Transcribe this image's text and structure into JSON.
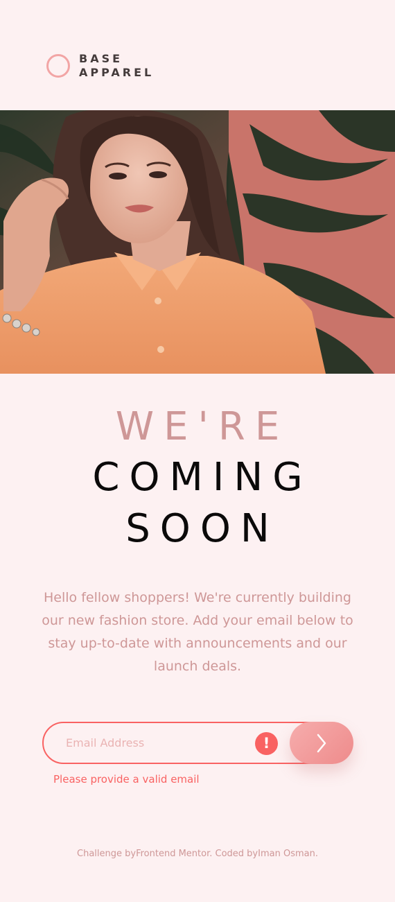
{
  "brand": {
    "line1": "BASE",
    "line2": "APPAREL"
  },
  "title": {
    "light": "WE'RE",
    "dark_line1": "COMING",
    "dark_line2": "SOON"
  },
  "description": "Hello fellow shoppers! We're currently building our new fashion store. Add your email below to stay up-to-date with announcements and our launch deals.",
  "form": {
    "email_placeholder": "Email Address",
    "email_value": "",
    "error_icon_glyph": "!",
    "error_message": "Please provide a valid email",
    "submit_icon": "chevron-right-icon"
  },
  "footer": {
    "prefix": "Challenge by",
    "challenge_link": "Frontend Mentor",
    "middle": ". Coded by",
    "author_link": "Iman Osman",
    "suffix": "."
  },
  "colors": {
    "background": "#fdf1f2",
    "accent_light": "#ce9797",
    "dark": "#0b0a0a",
    "error": "#f96262",
    "button_gradient_start": "#f6adad",
    "button_gradient_end": "#ee8b8b"
  }
}
